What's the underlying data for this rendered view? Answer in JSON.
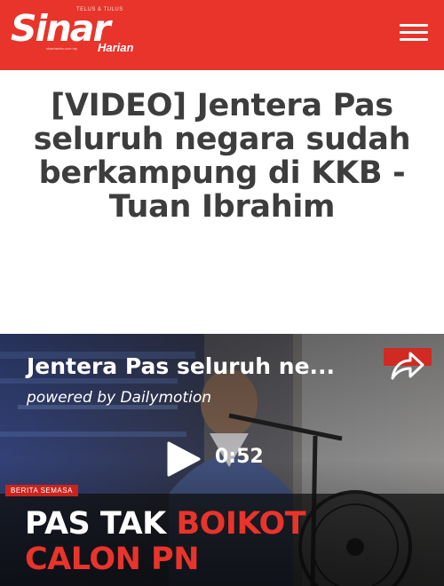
{
  "header": {
    "logo_main": "Sinar",
    "logo_sub": "Harian",
    "logo_tagline": "TELUS & TULUS",
    "logo_url": "sinarharian.com.my",
    "brand_color": "#e8342b",
    "menu_icon": "hamburger-menu-icon"
  },
  "article": {
    "title": "[VIDEO] Jentera Pas seluruh negara sudah berkampung di KKB - Tuan Ibrahim"
  },
  "video": {
    "title": "Jentera Pas seluruh ne...",
    "powered_by": "powered by Dailymotion",
    "duration": "0:52",
    "play_icon": "play-icon",
    "share_icon": "share-arrow-icon",
    "category_tag": "BERITA SEMASA",
    "caption_line1_white": "PAS TAK ",
    "caption_line1_red": "BOIKOT",
    "caption_line2": "CALON PN"
  }
}
